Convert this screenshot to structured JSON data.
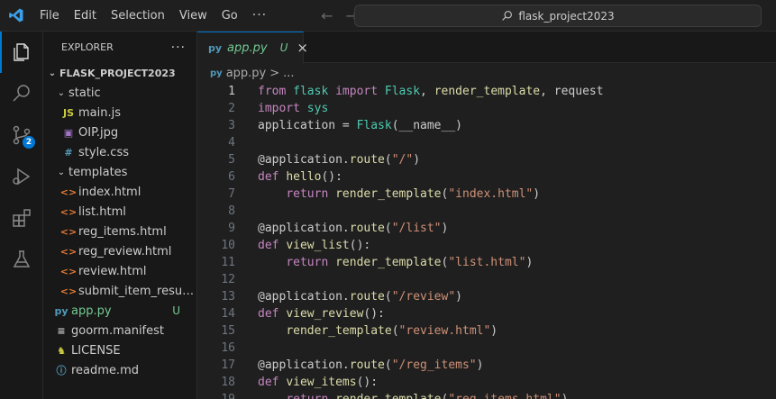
{
  "titlebar": {
    "menu": [
      "File",
      "Edit",
      "Selection",
      "View",
      "Go"
    ],
    "more": "···",
    "search_text": "flask_project2023"
  },
  "activitybar": {
    "scm_badge": "2"
  },
  "sidebar": {
    "title": "EXPLORER",
    "more": "···",
    "project": "FLASK_PROJECT2023",
    "items": [
      {
        "label": "static",
        "type": "folder",
        "depth": 1,
        "icon": "chevron-down-icon"
      },
      {
        "label": "main.js",
        "type": "file",
        "depth": 2,
        "icon_text": "JS",
        "icon_color": "#cbcb41"
      },
      {
        "label": "OIP.jpg",
        "type": "file",
        "depth": 2,
        "icon_text": "▣",
        "icon_color": "#a074c4"
      },
      {
        "label": "style.css",
        "type": "file",
        "depth": 2,
        "icon_text": "#",
        "icon_color": "#519aba"
      },
      {
        "label": "templates",
        "type": "folder",
        "depth": 1
      },
      {
        "label": "index.html",
        "type": "file",
        "depth": 2,
        "icon_text": "<>",
        "icon_color": "#e37933"
      },
      {
        "label": "list.html",
        "type": "file",
        "depth": 2,
        "icon_text": "<>",
        "icon_color": "#e37933"
      },
      {
        "label": "reg_items.html",
        "type": "file",
        "depth": 2,
        "icon_text": "<>",
        "icon_color": "#e37933"
      },
      {
        "label": "reg_review.html",
        "type": "file",
        "depth": 2,
        "icon_text": "<>",
        "icon_color": "#e37933"
      },
      {
        "label": "review.html",
        "type": "file",
        "depth": 2,
        "icon_text": "<>",
        "icon_color": "#e37933"
      },
      {
        "label": "submit_item_result....",
        "type": "file",
        "depth": 2,
        "icon_text": "<>",
        "icon_color": "#e37933"
      },
      {
        "label": "app.py",
        "type": "file",
        "depth": 1,
        "icon_text": "py",
        "icon_color": "#519aba",
        "status": "U"
      },
      {
        "label": "goorm.manifest",
        "type": "file",
        "depth": 1,
        "icon_text": "≡",
        "icon_color": "#cccccc"
      },
      {
        "label": "LICENSE",
        "type": "file",
        "depth": 1,
        "icon_text": "♞",
        "icon_color": "#cbcb41"
      },
      {
        "label": "readme.md",
        "type": "file",
        "depth": 1,
        "icon_text": "ⓘ",
        "icon_color": "#519aba"
      }
    ]
  },
  "tab": {
    "name": "app.py",
    "status": "U",
    "close": "×"
  },
  "breadcrumb": {
    "file": "app.py",
    "sep": ">",
    "rest": "..."
  },
  "code": [
    {
      "n": "1",
      "tokens": [
        [
          "kw",
          "from "
        ],
        [
          "mod",
          "flask "
        ],
        [
          "kw",
          "import "
        ],
        [
          "mod",
          "Flask"
        ],
        [
          "plain",
          ", "
        ],
        [
          "fn",
          "render_template"
        ],
        [
          "plain",
          ", "
        ],
        [
          "plain",
          "request"
        ]
      ]
    },
    {
      "n": "2",
      "tokens": [
        [
          "kw",
          "import "
        ],
        [
          "mod",
          "sys"
        ]
      ]
    },
    {
      "n": "3",
      "tokens": [
        [
          "plain",
          "application "
        ],
        [
          "plain",
          "= "
        ],
        [
          "mod",
          "Flask"
        ],
        [
          "plain",
          "(__name__)"
        ]
      ]
    },
    {
      "n": "4",
      "tokens": []
    },
    {
      "n": "5",
      "tokens": [
        [
          "deco",
          "@application"
        ],
        [
          "plain",
          "."
        ],
        [
          "attr",
          "route"
        ],
        [
          "plain",
          "("
        ],
        [
          "str",
          "\"/\""
        ],
        [
          "plain",
          ")"
        ]
      ]
    },
    {
      "n": "6",
      "tokens": [
        [
          "kw",
          "def "
        ],
        [
          "fn",
          "hello"
        ],
        [
          "plain",
          "():"
        ]
      ]
    },
    {
      "n": "7",
      "tokens": [
        [
          "plain",
          "    "
        ],
        [
          "kw",
          "return "
        ],
        [
          "fn",
          "render_template"
        ],
        [
          "plain",
          "("
        ],
        [
          "str",
          "\"index.html\""
        ],
        [
          "plain",
          ")"
        ]
      ]
    },
    {
      "n": "8",
      "tokens": []
    },
    {
      "n": "9",
      "tokens": [
        [
          "deco",
          "@application"
        ],
        [
          "plain",
          "."
        ],
        [
          "attr",
          "route"
        ],
        [
          "plain",
          "("
        ],
        [
          "str",
          "\"/list\""
        ],
        [
          "plain",
          ")"
        ]
      ]
    },
    {
      "n": "10",
      "tokens": [
        [
          "kw",
          "def "
        ],
        [
          "fn",
          "view_list"
        ],
        [
          "plain",
          "():"
        ]
      ]
    },
    {
      "n": "11",
      "tokens": [
        [
          "plain",
          "    "
        ],
        [
          "kw",
          "return "
        ],
        [
          "fn",
          "render_template"
        ],
        [
          "plain",
          "("
        ],
        [
          "str",
          "\"list.html\""
        ],
        [
          "plain",
          ")"
        ]
      ]
    },
    {
      "n": "12",
      "tokens": []
    },
    {
      "n": "13",
      "tokens": [
        [
          "deco",
          "@application"
        ],
        [
          "plain",
          "."
        ],
        [
          "attr",
          "route"
        ],
        [
          "plain",
          "("
        ],
        [
          "str",
          "\"/review\""
        ],
        [
          "plain",
          ")"
        ]
      ]
    },
    {
      "n": "14",
      "tokens": [
        [
          "kw",
          "def "
        ],
        [
          "fn",
          "view_review"
        ],
        [
          "plain",
          "():"
        ]
      ]
    },
    {
      "n": "15",
      "tokens": [
        [
          "plain",
          "    "
        ],
        [
          "fn",
          "render_template"
        ],
        [
          "plain",
          "("
        ],
        [
          "str",
          "\"review.html\""
        ],
        [
          "plain",
          ")"
        ]
      ]
    },
    {
      "n": "16",
      "tokens": []
    },
    {
      "n": "17",
      "tokens": [
        [
          "deco",
          "@application"
        ],
        [
          "plain",
          "."
        ],
        [
          "attr",
          "route"
        ],
        [
          "plain",
          "("
        ],
        [
          "str",
          "\"/reg_items\""
        ],
        [
          "plain",
          ")"
        ]
      ]
    },
    {
      "n": "18",
      "tokens": [
        [
          "kw",
          "def "
        ],
        [
          "fn",
          "view_items"
        ],
        [
          "plain",
          "():"
        ]
      ]
    },
    {
      "n": "19",
      "tokens": [
        [
          "plain",
          "    "
        ],
        [
          "kw",
          "return "
        ],
        [
          "fn",
          "render_template"
        ],
        [
          "plain",
          "("
        ],
        [
          "str",
          "\"reg_items.html\""
        ],
        [
          "plain",
          ")"
        ]
      ]
    }
  ],
  "current_line": "1"
}
